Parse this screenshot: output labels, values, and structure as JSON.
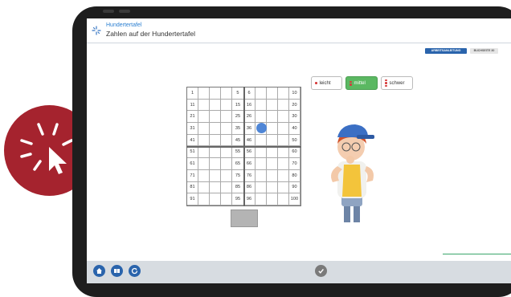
{
  "header": {
    "title": "Hundertertafel",
    "subtitle": "Zahlen auf der Hundertertafel"
  },
  "top_buttons": {
    "worksheet": "ARBEITSANLEITUNG",
    "book_page": "BUCHSEITE 30"
  },
  "difficulty": {
    "easy": "leicht",
    "medium": "mittel",
    "hard": "schwer",
    "selected": "mittel"
  },
  "grid": {
    "rows": [
      [
        "1",
        "",
        "",
        "",
        "5",
        "6",
        "",
        "",
        "",
        "10"
      ],
      [
        "11",
        "",
        "",
        "",
        "15",
        "16",
        "",
        "",
        "",
        "20"
      ],
      [
        "21",
        "",
        "",
        "",
        "25",
        "26",
        "",
        "",
        "",
        "30"
      ],
      [
        "31",
        "",
        "",
        "",
        "35",
        "36",
        "",
        "",
        "",
        "40"
      ],
      [
        "41",
        "",
        "",
        "",
        "45",
        "46",
        "",
        "",
        "",
        "50"
      ],
      [
        "51",
        "",
        "",
        "",
        "55",
        "56",
        "",
        "",
        "",
        "60"
      ],
      [
        "61",
        "",
        "",
        "",
        "65",
        "66",
        "",
        "",
        "",
        "70"
      ],
      [
        "71",
        "",
        "",
        "",
        "75",
        "76",
        "",
        "",
        "",
        "80"
      ],
      [
        "81",
        "",
        "",
        "",
        "85",
        "86",
        "",
        "",
        "",
        "90"
      ],
      [
        "91",
        "",
        "",
        "",
        "95",
        "96",
        "",
        "",
        "",
        "100"
      ]
    ]
  },
  "footer": {
    "icons": [
      "home-icon",
      "book-icon",
      "refresh-icon",
      "check-icon"
    ]
  },
  "colors": {
    "accent": "#2a64ac",
    "badge": "#a5232e",
    "active": "#5bb862",
    "marker": "#4f86d6"
  }
}
